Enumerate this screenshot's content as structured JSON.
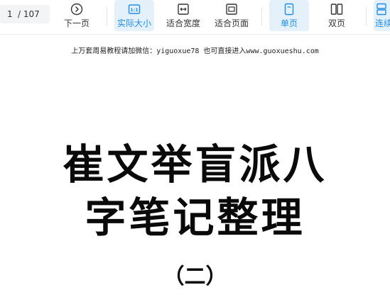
{
  "toolbar": {
    "page_current": "1",
    "page_total": "/ 107",
    "buttons": {
      "next_page": "下一页",
      "actual_size": "实际大小",
      "fit_width": "适合宽度",
      "fit_page": "适合页面",
      "single_page": "单页",
      "double_page": "双页",
      "continuous": "连续"
    },
    "accent_color": "#1e8ee6"
  },
  "document": {
    "watermark": "上万套周易教程请加微信：yiguoxue78  也可直接进入www.guoxueshu.com",
    "title_line1": "崔文举盲派八",
    "title_line2": "字笔记整理",
    "subtitle": "（二）"
  }
}
